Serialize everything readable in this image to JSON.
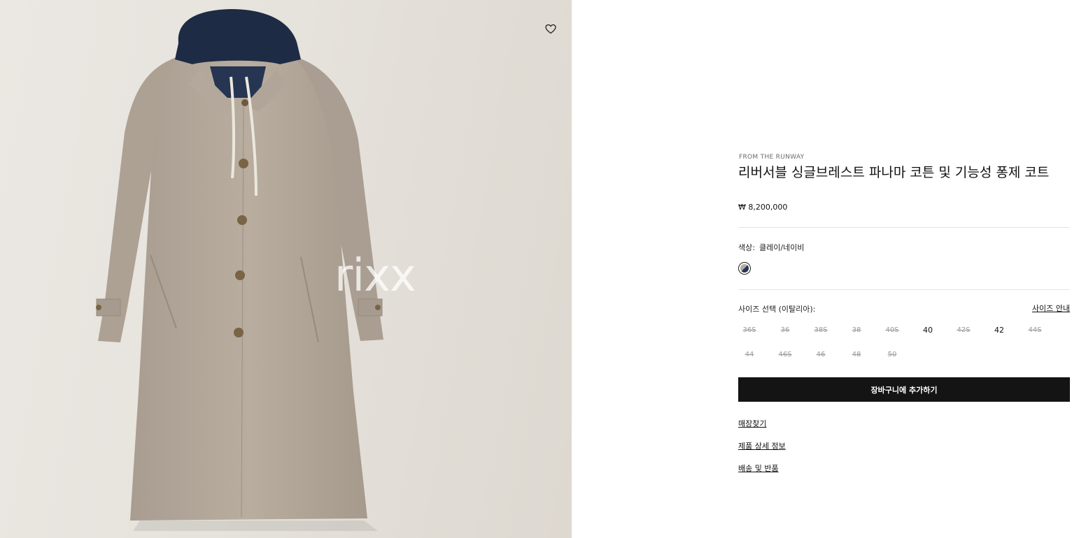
{
  "product": {
    "eyebrow": "FROM THE RUNWAY",
    "title": "리버서블 싱글브레스트 파나마 코튼 및 기능성 퐁제 코트",
    "price": "₩ 8,200,000",
    "watermark": "rixx"
  },
  "color": {
    "label": "색상:",
    "value": "클레이/네이비",
    "swatch_colors": [
      "#b5aca1",
      "#253552"
    ]
  },
  "size": {
    "label": "사이즈 선택 (이탈리아):",
    "guide_label": "사이즈 안내",
    "options": [
      {
        "label": "36S",
        "available": false
      },
      {
        "label": "36",
        "available": false
      },
      {
        "label": "38S",
        "available": false
      },
      {
        "label": "38",
        "available": false
      },
      {
        "label": "40S",
        "available": false
      },
      {
        "label": "40",
        "available": true
      },
      {
        "label": "42S",
        "available": false
      },
      {
        "label": "42",
        "available": true
      },
      {
        "label": "44S",
        "available": false
      },
      {
        "label": "44",
        "available": false
      },
      {
        "label": "46S",
        "available": false
      },
      {
        "label": "46",
        "available": false
      },
      {
        "label": "48",
        "available": false
      },
      {
        "label": "50",
        "available": false
      }
    ]
  },
  "cart": {
    "label": "장바구니에 추가하기"
  },
  "links": [
    {
      "label": "매장찾기"
    },
    {
      "label": "제품 상세 정보"
    },
    {
      "label": "배송 및 반품"
    }
  ],
  "icons": {
    "wishlist": "heart-outline-icon"
  }
}
